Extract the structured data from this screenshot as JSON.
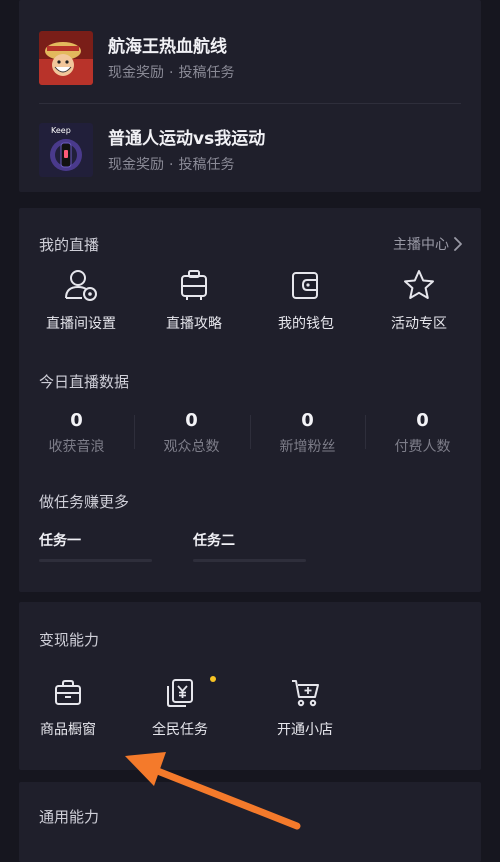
{
  "nav": {
    "back_icon": "chevron-left-icon"
  },
  "tasks": [
    {
      "title": "航海王热血航线",
      "reward": "现金奖励",
      "sep": "·",
      "type": "投稿任务",
      "thumb": "anime-game-thumbnail"
    },
    {
      "title": "普通人运动vs我运动",
      "reward": "现金奖励",
      "sep": "·",
      "type": "投稿任务",
      "thumb": "keep-fitness-thumbnail",
      "thumb_text": "Keep"
    }
  ],
  "live": {
    "title": "我的直播",
    "center_link": "主播中心",
    "actions": [
      {
        "label": "直播间设置",
        "icon": "user-settings-icon"
      },
      {
        "label": "直播攻略",
        "icon": "guide-icon"
      },
      {
        "label": "我的钱包",
        "icon": "wallet-icon"
      },
      {
        "label": "活动专区",
        "icon": "star-icon"
      }
    ],
    "today_title": "今日直播数据",
    "stats": [
      {
        "value": "0",
        "label": "收获音浪"
      },
      {
        "value": "0",
        "label": "观众总数"
      },
      {
        "value": "0",
        "label": "新增粉丝"
      },
      {
        "value": "0",
        "label": "付费人数"
      }
    ],
    "tasks_title": "做任务赚更多",
    "task_tabs": [
      "任务一",
      "任务二"
    ]
  },
  "monetize": {
    "title": "变现能力",
    "actions": [
      {
        "label": "商品橱窗",
        "icon": "shopping-bag-icon"
      },
      {
        "label": "全民任务",
        "icon": "yuan-task-icon",
        "badge": true
      },
      {
        "label": "开通小店",
        "icon": "shopping-cart-icon"
      }
    ]
  },
  "general": {
    "title": "通用能力"
  },
  "colors": {
    "background": "#16161f",
    "card": "#1f1f2b",
    "badge": "#f7c324",
    "annotation_arrow": "#f47a2b"
  }
}
